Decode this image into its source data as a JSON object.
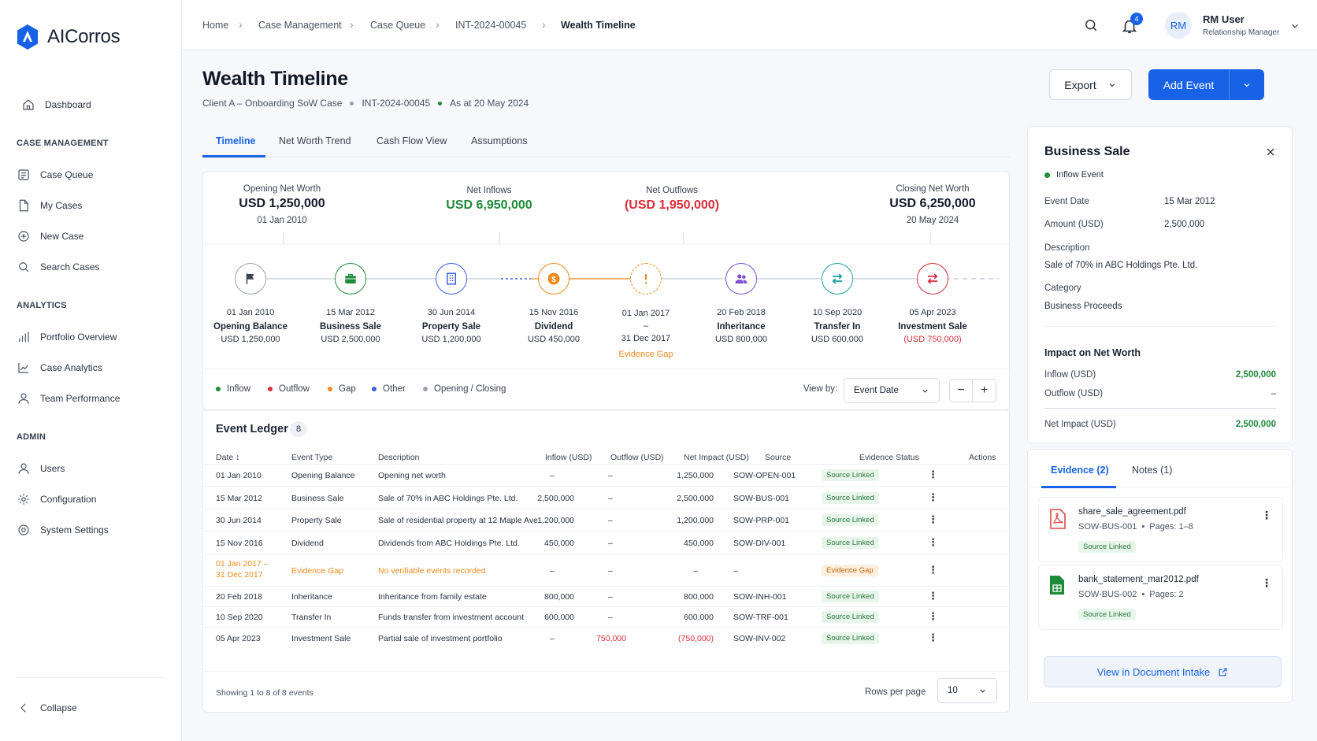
{
  "app": {
    "name": "AICorros"
  },
  "sidebar": {
    "dashboard": "Dashboard",
    "sections": [
      {
        "title": "CASE MANAGEMENT",
        "items": [
          "Case Queue",
          "My Cases",
          "New Case",
          "Search Cases"
        ]
      },
      {
        "title": "ANALYTICS",
        "items": [
          "Portfolio Overview",
          "Case Analytics",
          "Team Performance"
        ]
      },
      {
        "title": "ADMIN",
        "items": [
          "Users",
          "Configuration",
          "System Settings"
        ]
      }
    ],
    "collapse": "Collapse"
  },
  "breadcrumb": [
    "Home",
    "Case Management",
    "Case Queue",
    "INT-2024-00045",
    "Wealth Timeline"
  ],
  "header": {
    "notif_count": "4",
    "avatar": "RM",
    "user_name": "RM User",
    "user_role": "Relationship Manager"
  },
  "page": {
    "title": "Wealth Timeline",
    "subtitle_client": "Client A – Onboarding SoW Case",
    "subtitle_case": "INT-2024-00045",
    "subtitle_asat": "As at 20 May 2024",
    "export": "Export",
    "add_event": "Add Event"
  },
  "tabs": [
    "Timeline",
    "Net Worth Trend",
    "Cash Flow View",
    "Assumptions"
  ],
  "summary": {
    "opening": {
      "label": "Opening Net Worth",
      "value": "USD 1,250,000",
      "date": "01 Jan 2010"
    },
    "inflows": {
      "label": "Net Inflows",
      "value": "USD 6,950,000"
    },
    "outflows": {
      "label": "Net Outflows",
      "value": "(USD 1,950,000)"
    },
    "closing": {
      "label": "Closing Net Worth",
      "value": "USD 6,250,000",
      "date": "20 May 2024"
    }
  },
  "timeline": [
    {
      "date": "01 Jan 2010",
      "name": "Opening Balance",
      "amount": "USD 1,250,000",
      "icon": "flag-icon"
    },
    {
      "date": "15 Mar 2012",
      "name": "Business Sale",
      "amount": "USD 2,500,000",
      "icon": "briefcase-icon"
    },
    {
      "date": "30 Jun 2014",
      "name": "Property Sale",
      "amount": "USD 1,200,000",
      "icon": "building-icon"
    },
    {
      "date": "15 Nov 2016",
      "name": "Dividend",
      "amount": "USD 450,000",
      "icon": "dollar-icon"
    },
    {
      "date": "01 Jan 2017",
      "date_sep": "–",
      "date2": "31 Dec 2017",
      "name": "Evidence Gap",
      "icon": "alert-icon"
    },
    {
      "date": "20 Feb 2018",
      "name": "Inheritance",
      "amount": "USD 800,000",
      "icon": "people-icon"
    },
    {
      "date": "10 Sep 2020",
      "name": "Transfer In",
      "amount": "USD 600,000",
      "icon": "transfer-icon"
    },
    {
      "date": "05 Apr 2023",
      "name": "Investment Sale",
      "amount": "(USD 750,000)",
      "icon": "swap-icon"
    }
  ],
  "legend": [
    "Inflow",
    "Outflow",
    "Gap",
    "Other",
    "Opening / Closing"
  ],
  "view_by": {
    "label": "View by:",
    "value": "Event Date"
  },
  "ledger": {
    "title": "Event Ledger",
    "count": "8",
    "columns": [
      "Date",
      "Event Type",
      "Description",
      "Inflow (USD)",
      "Outflow (USD)",
      "Net Impact (USD)",
      "Source",
      "Evidence Status",
      "Actions"
    ],
    "rows": [
      {
        "date": "01 Jan 2010",
        "type": "Opening Balance",
        "desc": "Opening net worth",
        "in": "–",
        "out": "–",
        "net": "1,250,000",
        "src": "SOW-OPEN-001",
        "status": "Source Linked"
      },
      {
        "date": "15 Mar 2012",
        "type": "Business Sale",
        "desc": "Sale of 70% in ABC Holdings Pte. Ltd.",
        "in": "2,500,000",
        "out": "–",
        "net": "2,500,000",
        "src": "SOW-BUS-001",
        "status": "Source Linked"
      },
      {
        "date": "30 Jun 2014",
        "type": "Property Sale",
        "desc": "Sale of residential property at 12 Maple Ave",
        "in": "1,200,000",
        "out": "–",
        "net": "1,200,000",
        "src": "SOW-PRP-001",
        "status": "Source Linked"
      },
      {
        "date": "15 Nov 2016",
        "type": "Dividend",
        "desc": "Dividends from ABC Holdings Pte. Ltd.",
        "in": "450,000",
        "out": "–",
        "net": "450,000",
        "src": "SOW-DIV-001",
        "status": "Source Linked"
      },
      {
        "date": "01 Jan 2017 –",
        "date2": "31 Dec 2017",
        "type": "Evidence Gap",
        "desc": "No verifiable events recorded",
        "in": "–",
        "out": "–",
        "net": "–",
        "src": "–",
        "status": "Evidence Gap"
      },
      {
        "date": "20 Feb 2018",
        "type": "Inheritance",
        "desc": "Inheritance from family estate",
        "in": "800,000",
        "out": "–",
        "net": "800,000",
        "src": "SOW-INH-001",
        "status": "Source Linked"
      },
      {
        "date": "10 Sep 2020",
        "type": "Transfer In",
        "desc": "Funds transfer from investment account",
        "in": "600,000",
        "out": "–",
        "net": "600,000",
        "src": "SOW-TRF-001",
        "status": "Source Linked"
      },
      {
        "date": "05 Apr 2023",
        "type": "Investment Sale",
        "desc": "Partial sale of investment portfolio",
        "in": "–",
        "out": "750,000",
        "net": "(750,000)",
        "src": "SOW-INV-002",
        "status": "Source Linked"
      }
    ],
    "footer": "Showing 1 to 8 of 8 events",
    "rows_per_page_label": "Rows per page",
    "rows_per_page": "10"
  },
  "detail": {
    "title": "Business Sale",
    "type": "Inflow Event",
    "event_date_label": "Event Date",
    "event_date": "15 Mar 2012",
    "amount_label": "Amount (USD)",
    "amount": "2,500,000",
    "description_label": "Description",
    "description": "Sale of 70% in ABC Holdings Pte. Ltd.",
    "category_label": "Category",
    "category": "Business Proceeds",
    "impact_title": "Impact on Net Worth",
    "inflow_label": "Inflow (USD)",
    "inflow": "2,500,000",
    "outflow_label": "Outflow (USD)",
    "outflow": "–",
    "net_label": "Net Impact (USD)",
    "net": "2,500,000"
  },
  "evidence": {
    "tab_evidence": "Evidence (2)",
    "tab_notes": "Notes (1)",
    "docs": [
      {
        "name": "share_sale_agreement.pdf",
        "ref": "SOW-BUS-001",
        "pages": "Pages: 1–8",
        "status": "Source Linked"
      },
      {
        "name": "bank_statement_mar2012.pdf",
        "ref": "SOW-BUS-002",
        "pages": "Pages: 2",
        "status": "Source Linked"
      }
    ],
    "view_btn": "View in Document Intake"
  },
  "colors": {
    "primary": "#1762e6",
    "inflow": "#1f8a3a",
    "outflow": "#d92d3a",
    "gap": "#f08a1c",
    "other": "#3b5fe0",
    "neutral": "#9aa1ad"
  }
}
